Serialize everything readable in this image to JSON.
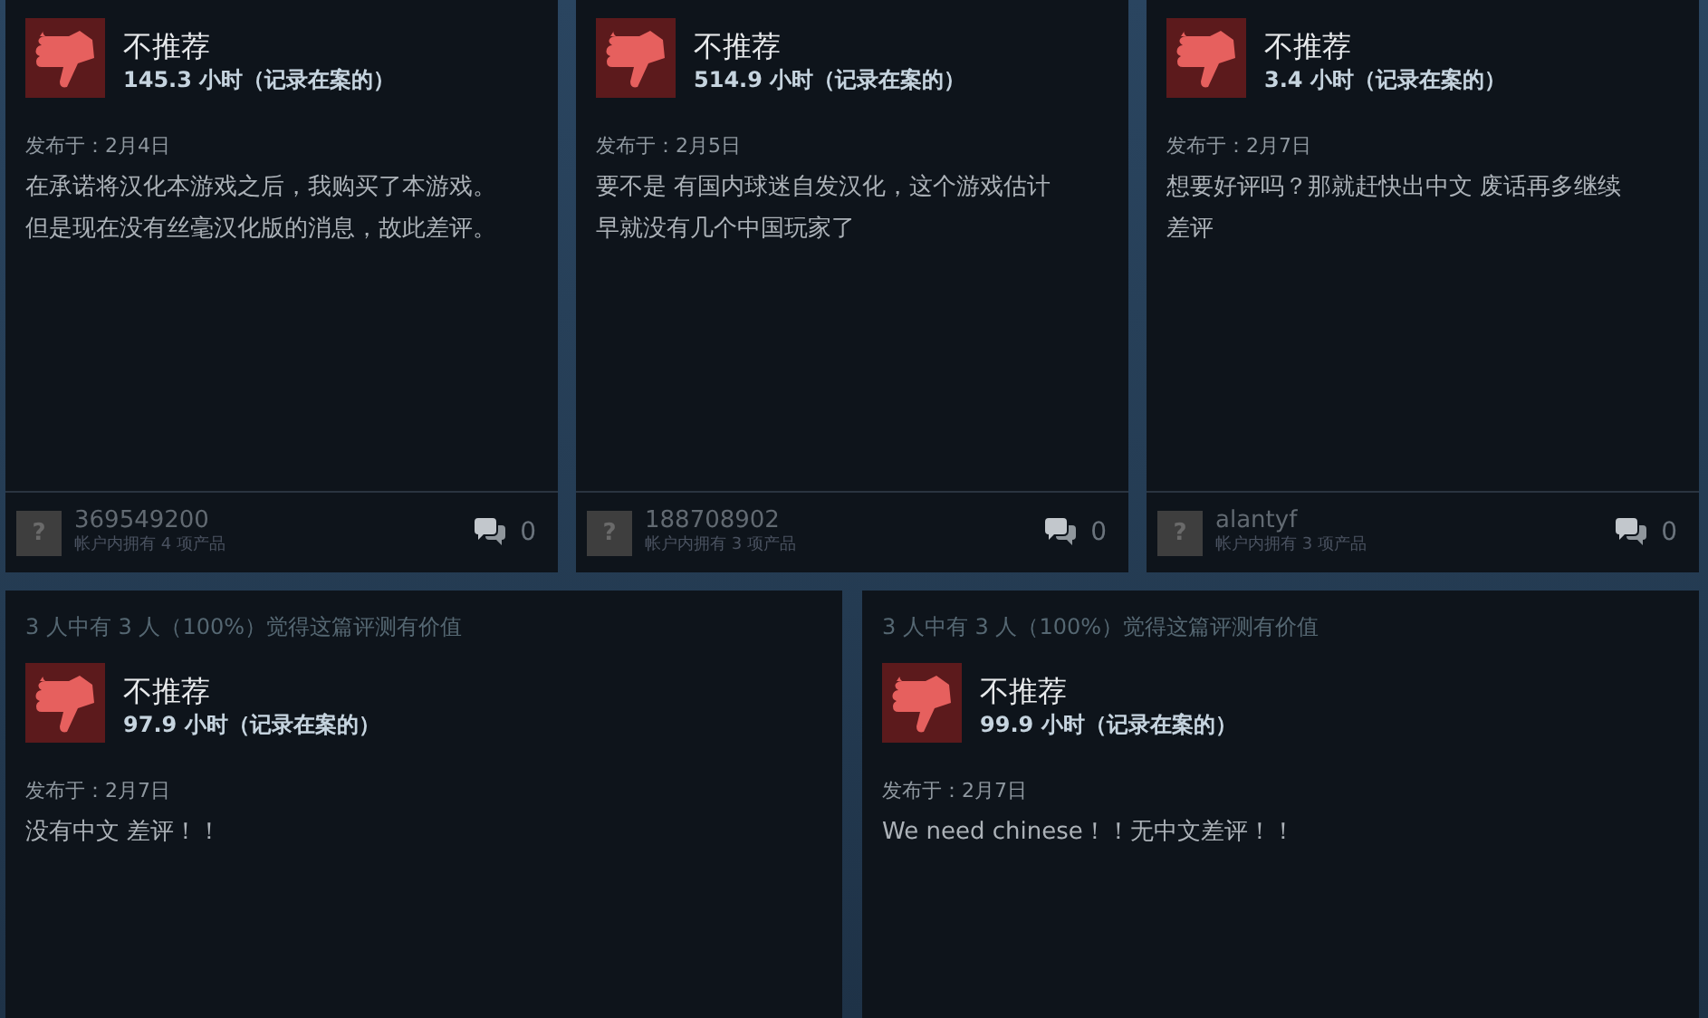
{
  "reviews_top": [
    {
      "verdict": "不推荐",
      "recommended": false,
      "hours": "145.3 小时（记录在案的）",
      "posted": "发布于：2月4日",
      "body": "在承诺将汉化本游戏之后，我购买了本游戏。但是现在没有丝毫汉化版的消息，故此差评。",
      "avatar": "?",
      "user": "369549200",
      "products": "帐户内拥有 4 项产品",
      "comments": "0"
    },
    {
      "verdict": "不推荐",
      "recommended": false,
      "hours": "514.9 小时（记录在案的）",
      "posted": "发布于：2月5日",
      "body": "要不是 有国内球迷自发汉化，这个游戏估计早就没有几个中国玩家了",
      "avatar": "?",
      "user": "188708902",
      "products": "帐户内拥有 3 项产品",
      "comments": "0"
    },
    {
      "verdict": "不推荐",
      "recommended": false,
      "hours": "3.4 小时（记录在案的）",
      "posted": "发布于：2月7日",
      "body": "想要好评吗？那就赶快出中文 废话再多继续差评",
      "avatar": "?",
      "user": "alantyf",
      "products": "帐户内拥有 3 项产品",
      "comments": "0"
    }
  ],
  "reviews_bottom": [
    {
      "helpful": "3 人中有 3 人（100%）觉得这篇评测有价值",
      "verdict": "不推荐",
      "recommended": false,
      "hours": "97.9 小时（记录在案的）",
      "posted": "发布于：2月7日",
      "body": "没有中文 差评！！"
    },
    {
      "helpful": "3 人中有 3 人（100%）觉得这篇评测有价值",
      "verdict": "不推荐",
      "recommended": false,
      "hours": "99.9 小时（记录在案的）",
      "posted": "发布于：2月7日",
      "body": "We need chinese！！无中文差评！！"
    }
  ]
}
